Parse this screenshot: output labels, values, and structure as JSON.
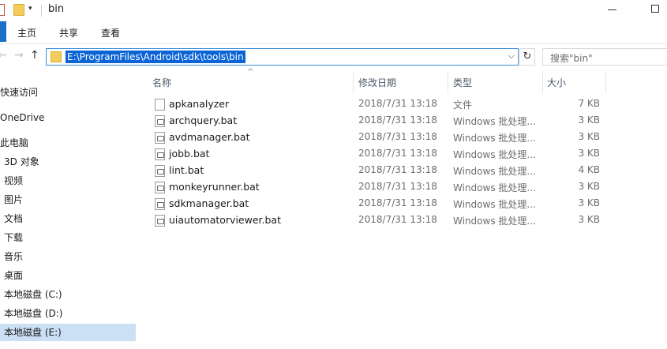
{
  "window": {
    "title": "bin"
  },
  "ribbon": {
    "tabs": [
      "主页",
      "共享",
      "查看"
    ]
  },
  "address": {
    "path": "E:\\ProgramFiles\\Android\\sdk\\tools\\bin",
    "search_placeholder": "搜索\"bin\""
  },
  "nav": {
    "items": [
      {
        "label": "快速访问"
      },
      {
        "label": "OneDrive"
      },
      {
        "label": "此电脑"
      },
      {
        "label": "3D 对象"
      },
      {
        "label": "视频"
      },
      {
        "label": "图片"
      },
      {
        "label": "文档"
      },
      {
        "label": "下载"
      },
      {
        "label": "音乐"
      },
      {
        "label": "桌面"
      },
      {
        "label": "本地磁盘 (C:)"
      },
      {
        "label": "本地磁盘 (D:)"
      },
      {
        "label": "本地磁盘 (E:)",
        "selected": true
      }
    ]
  },
  "columns": {
    "name": "名称",
    "date": "修改日期",
    "type": "类型",
    "size": "大小"
  },
  "files": [
    {
      "name": "apkanalyzer",
      "date": "2018/7/31 13:18",
      "type": "文件",
      "size": "7 KB",
      "icon": "file-icon"
    },
    {
      "name": "archquery.bat",
      "date": "2018/7/31 13:18",
      "type": "Windows 批处理...",
      "size": "3 KB",
      "icon": "batch-file-icon"
    },
    {
      "name": "avdmanager.bat",
      "date": "2018/7/31 13:18",
      "type": "Windows 批处理...",
      "size": "3 KB",
      "icon": "batch-file-icon"
    },
    {
      "name": "jobb.bat",
      "date": "2018/7/31 13:18",
      "type": "Windows 批处理...",
      "size": "3 KB",
      "icon": "batch-file-icon"
    },
    {
      "name": "lint.bat",
      "date": "2018/7/31 13:18",
      "type": "Windows 批处理...",
      "size": "4 KB",
      "icon": "batch-file-icon"
    },
    {
      "name": "monkeyrunner.bat",
      "date": "2018/7/31 13:18",
      "type": "Windows 批处理...",
      "size": "3 KB",
      "icon": "batch-file-icon"
    },
    {
      "name": "sdkmanager.bat",
      "date": "2018/7/31 13:18",
      "type": "Windows 批处理...",
      "size": "3 KB",
      "icon": "batch-file-icon"
    },
    {
      "name": "uiautomatorviewer.bat",
      "date": "2018/7/31 13:18",
      "type": "Windows 批处理...",
      "size": "3 KB",
      "icon": "batch-file-icon"
    }
  ],
  "colors": {
    "accent": "#0a64d6",
    "selection": "#cce0f5",
    "folder": "#f2cd5c"
  }
}
